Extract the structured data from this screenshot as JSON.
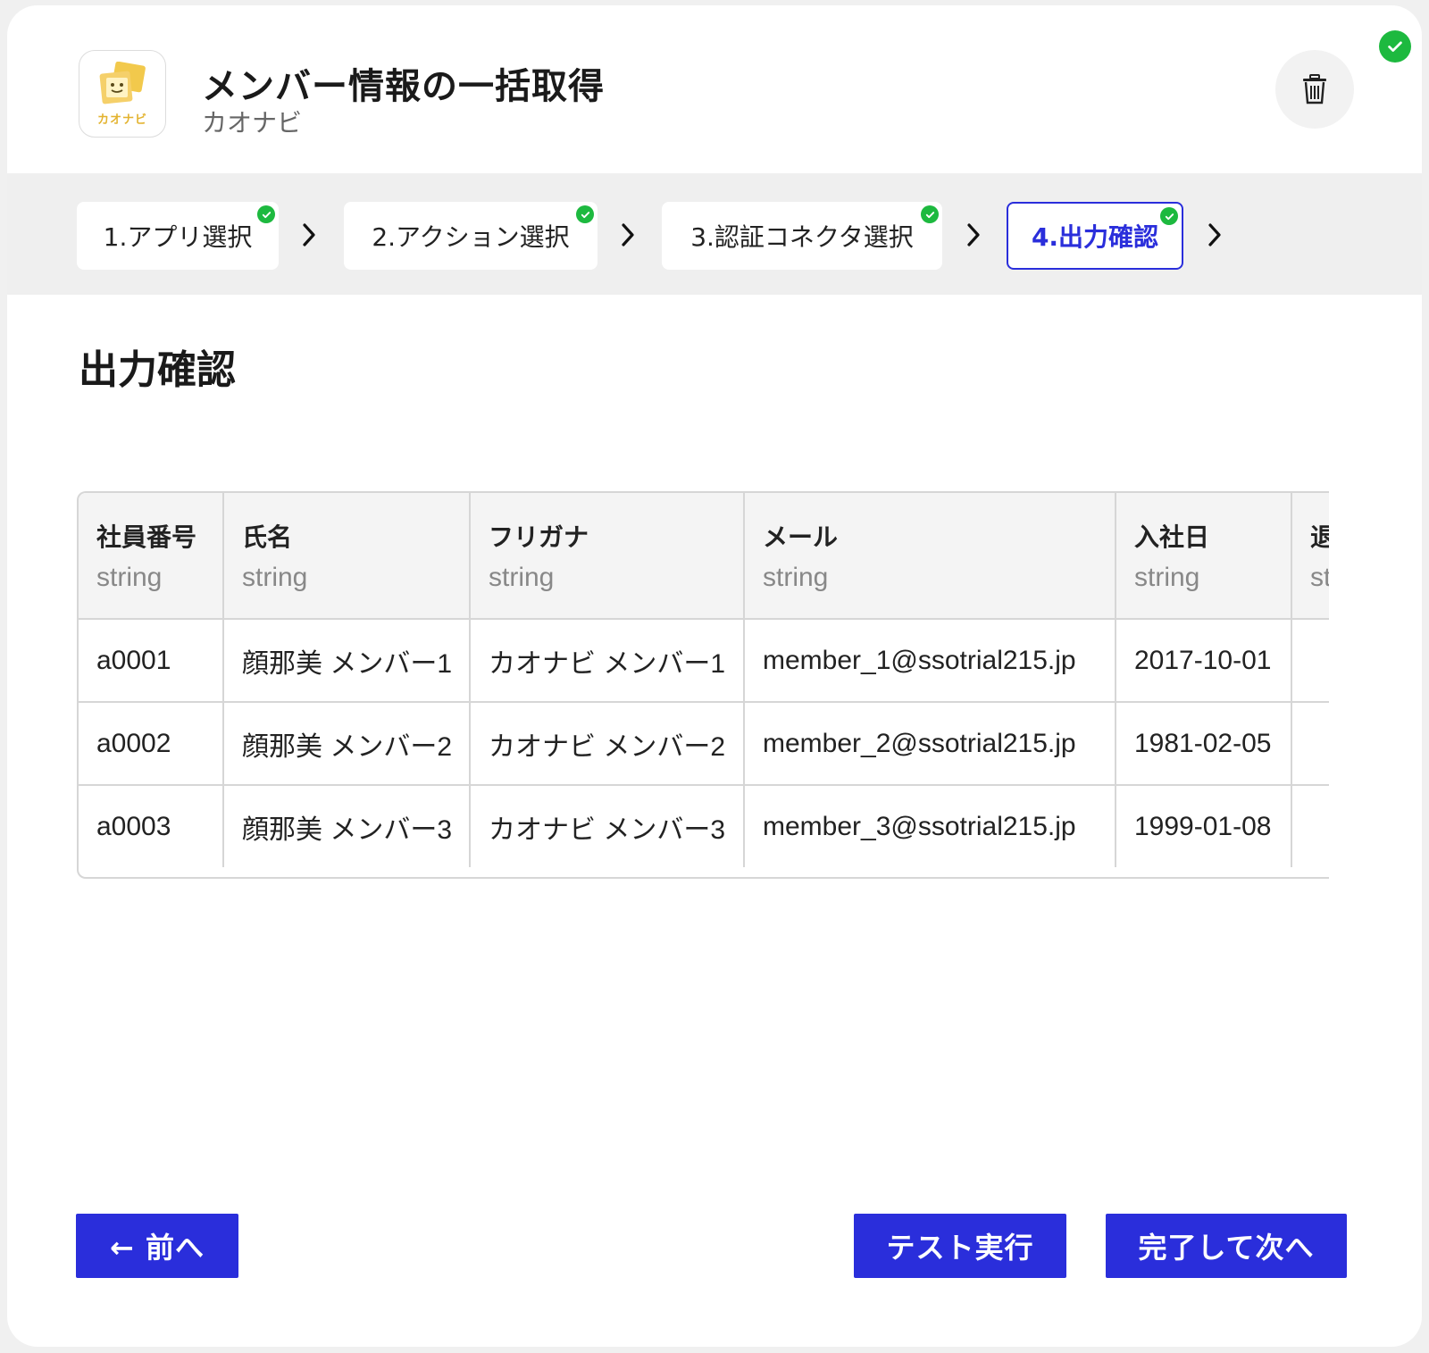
{
  "header": {
    "title": "メンバー情報の一括取得",
    "subtitle": "カオナビ",
    "logo_text": "カオナビ",
    "logo_icon": "kaonavi-logo",
    "delete_icon": "trash-icon"
  },
  "status": {
    "icon": "check-circle-icon",
    "color": "#1db93f"
  },
  "steps": [
    {
      "label": "1.アプリ選択",
      "completed": true
    },
    {
      "label": "2.アクション選択",
      "completed": true
    },
    {
      "label": "3.認証コネクタ選択",
      "completed": true
    },
    {
      "label": "4.出力確認",
      "completed": true,
      "active": true
    }
  ],
  "section": {
    "title": "出力確認"
  },
  "table": {
    "columns": [
      {
        "name": "社員番号",
        "type": "string"
      },
      {
        "name": "氏名",
        "type": "string"
      },
      {
        "name": "フリガナ",
        "type": "string"
      },
      {
        "name": "メール",
        "type": "string"
      },
      {
        "name": "入社日",
        "type": "string"
      },
      {
        "name": "退職",
        "type": "stri"
      }
    ],
    "rows": [
      [
        "a0001",
        "顔那美 メンバー1",
        "カオナビ メンバー1",
        "member_1@ssotrial215.jp",
        "2017-10-01",
        ""
      ],
      [
        "a0002",
        "顔那美 メンバー2",
        "カオナビ メンバー2",
        "member_2@ssotrial215.jp",
        "1981-02-05",
        ""
      ],
      [
        "a0003",
        "顔那美 メンバー3",
        "カオナビ メンバー3",
        "member_3@ssotrial215.jp",
        "1999-01-08",
        ""
      ]
    ]
  },
  "buttons": {
    "prev": "← 前へ",
    "test": "テスト実行",
    "next": "完了して次へ"
  },
  "colors": {
    "accent": "#2a2edb",
    "success": "#1db93f",
    "logo": "#e3b32f"
  }
}
